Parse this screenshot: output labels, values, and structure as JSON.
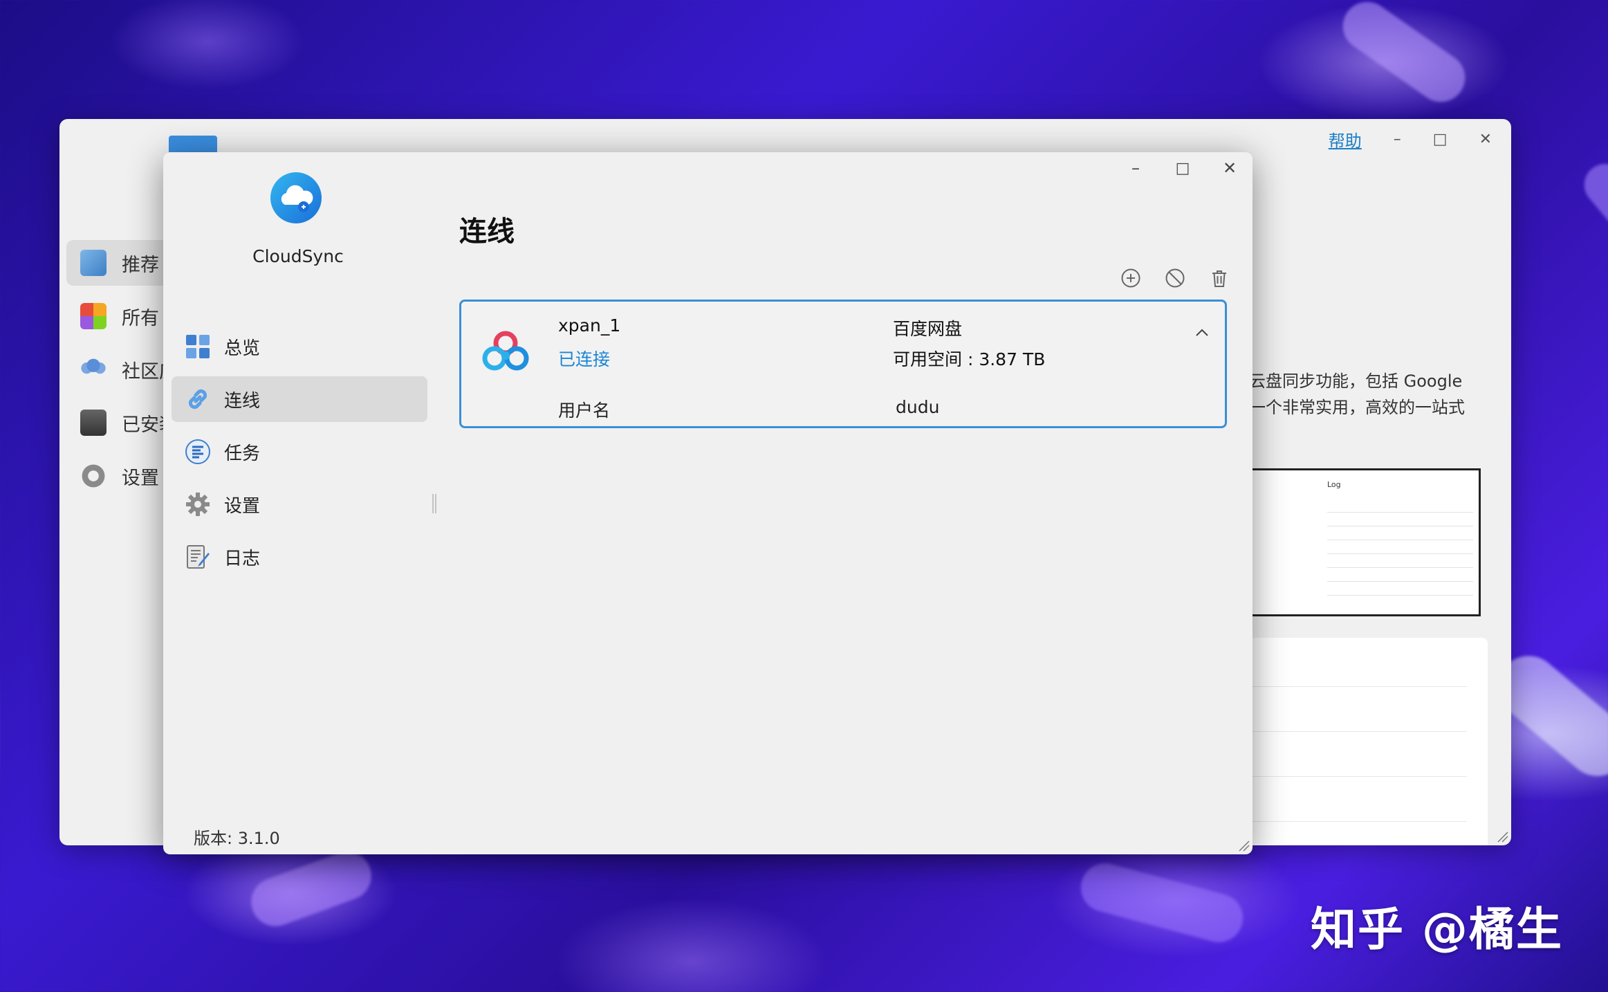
{
  "back_window": {
    "help_label": "帮助",
    "sidebar": [
      {
        "label": "推荐",
        "icon": "thumbs-up-icon"
      },
      {
        "label": "所有",
        "icon": "apps-grid-icon"
      },
      {
        "label": "社区应",
        "icon": "community-icon"
      },
      {
        "label": "已安装",
        "icon": "installed-icon"
      },
      {
        "label": "设置",
        "icon": "gear-icon"
      }
    ],
    "desc_line1": "云盘同步功能，包括 Google",
    "desc_line2": "一个非常实用，高效的一站式",
    "screenshot_title": "Log"
  },
  "app": {
    "name": "CloudSync",
    "version": "版本: 3.1.0"
  },
  "nav": [
    {
      "label": "总览",
      "icon": "overview-icon"
    },
    {
      "label": "连线",
      "icon": "link-icon"
    },
    {
      "label": "任务",
      "icon": "task-list-icon"
    },
    {
      "label": "设置",
      "icon": "gear-icon"
    },
    {
      "label": "日志",
      "icon": "log-icon"
    }
  ],
  "page": {
    "title": "连线"
  },
  "toolbar": {
    "add_icon": "plus-circle-icon",
    "disable_icon": "ban-icon",
    "delete_icon": "trash-icon"
  },
  "connection": {
    "name": "xpan_1",
    "status": "已连接",
    "provider": "百度网盘",
    "space": "可用空间 : 3.87 TB",
    "user_label": "用户名",
    "user_value": "dudu"
  },
  "watermark": "知乎 @橘生",
  "colors": {
    "accent": "#1b86d6",
    "card_border": "#3a8fd6"
  }
}
